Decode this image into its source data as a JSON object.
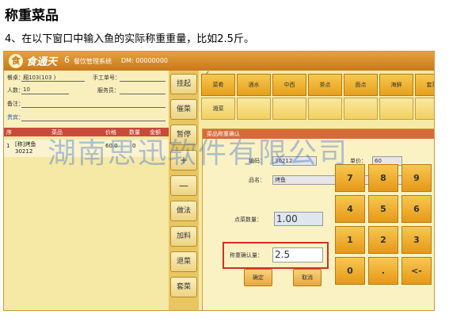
{
  "page_title": "称重菜品",
  "instruction": "4、在以下窗口中输入鱼的实际称重重量，比如2.5斤。",
  "app": {
    "brand": "食通天",
    "version": "6",
    "subtitle": "餐饮管理系统",
    "dm": "DM: 00000000",
    "logo": "食"
  },
  "order_info": {
    "table_label": "餐桌：",
    "table_value": "厢103(103 )",
    "manual_no_label": "手工单号：",
    "people_label": "人数：",
    "people_value": "10",
    "waiter_label": "服务员：",
    "note_label": "备注：",
    "vip_label": "贵宾："
  },
  "items_table": {
    "headers": [
      "序",
      "菜品",
      "价格",
      "数量",
      "金额"
    ],
    "rows": [
      {
        "no": "1",
        "name": "[称]烤鱼",
        "code": "30212",
        "price": "60.0",
        "qty": "0"
      }
    ]
  },
  "left_buttons": [
    "挂起",
    "催菜",
    "暂停",
    "+",
    "—",
    "做法",
    "加料",
    "退菜",
    "套菜"
  ],
  "categories": [
    "菜肴",
    "酒水",
    "中西",
    "茶点",
    "面点",
    "海鲜",
    "套菜"
  ],
  "subcategories": [
    "湘菜"
  ],
  "dialog": {
    "title": "菜品称重确认",
    "code_label": "编码：",
    "code_value": "30212",
    "price_label": "单价：",
    "price_value": "60",
    "name_label": "品名：",
    "name_value": "烤鱼",
    "qty_label": "点菜数量：",
    "qty_value": "1.00",
    "weight_label": "称重确认量：",
    "weight_value": "2.5",
    "confirm": "确定",
    "cancel": "取消"
  },
  "keypad": [
    "7",
    "8",
    "9",
    "4",
    "5",
    "6",
    "1",
    "2",
    "3",
    "0",
    ".",
    "<-"
  ],
  "watermark": "湖南思迅软件有限公司"
}
